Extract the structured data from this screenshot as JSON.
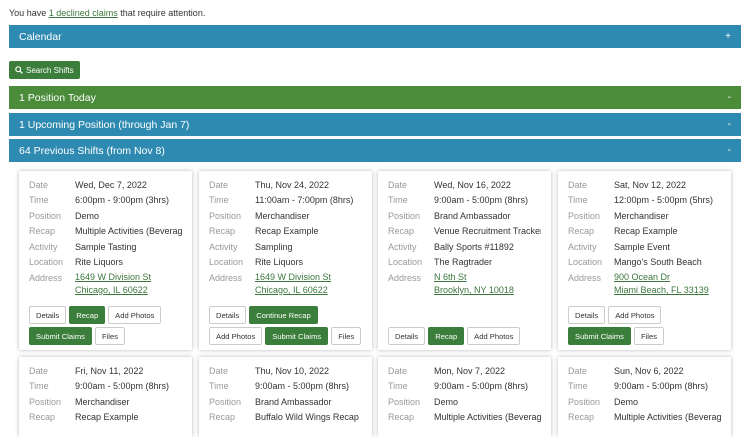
{
  "notice": {
    "prefix": "You have ",
    "link": "1 declined claims",
    "suffix": " that require attention."
  },
  "bars": {
    "calendar": {
      "label": "Calendar",
      "toggle": "+"
    },
    "today": {
      "label": "1 Position Today",
      "toggle": "-"
    },
    "upcoming": {
      "label": "1 Upcoming Position (through Jan 7)",
      "toggle": "-"
    },
    "previous": {
      "label": "64 Previous Shifts (from Nov 8)",
      "toggle": "-"
    }
  },
  "search_label": "Search Shifts",
  "labels": {
    "date": "Date",
    "time": "Time",
    "position": "Position",
    "recap": "Recap",
    "activity": "Activity",
    "location": "Location",
    "address": "Address"
  },
  "cards": [
    {
      "date": "Wed, Dec 7, 2022",
      "time": "6:00pm - 9:00pm (3hrs)",
      "position": "Demo",
      "recap": "Multiple Activities (Beverage)",
      "activity": "Sample Tasting",
      "location": "Rite Liquors",
      "addr1": "1649 W Division St",
      "addr2": "Chicago, IL 60622",
      "buttons": [
        {
          "label": "Details"
        },
        {
          "label": "Recap"
        },
        {
          "label": "Add Photos"
        },
        {
          "label": "Submit Claims"
        },
        {
          "label": "Files"
        }
      ]
    },
    {
      "date": "Thu, Nov 24, 2022",
      "time": "11:00am - 7:00pm (8hrs)",
      "position": "Merchandiser",
      "recap": "Recap Example",
      "activity": "Sampling",
      "location": "Rite Liquors",
      "addr1": "1649 W Division St",
      "addr2": "Chicago, IL 60622",
      "buttons": [
        {
          "label": "Details"
        },
        {
          "label": "Continue Recap"
        },
        {
          "label": "Add Photos"
        },
        {
          "label": "Submit Claims"
        },
        {
          "label": "Files"
        }
      ]
    },
    {
      "date": "Wed, Nov 16, 2022",
      "time": "9:00am - 5:00pm (8hrs)",
      "position": "Brand Ambassador",
      "recap": "Venue Recruitment Tracker",
      "activity": "Bally Sports #11892",
      "location": "The Ragtrader",
      "addr1": "N 6th St",
      "addr2": "Brooklyn, NY 10018",
      "buttons": [
        {
          "label": "Details"
        },
        {
          "label": "Recap"
        },
        {
          "label": "Add Photos"
        }
      ]
    },
    {
      "date": "Sat, Nov 12, 2022",
      "time": "12:00pm - 5:00pm (5hrs)",
      "position": "Merchandiser",
      "recap": "Recap Example",
      "activity": "Sample Event",
      "location": "Mango's South Beach",
      "addr1": "900 Ocean Dr",
      "addr2": "Miami Beach, FL 33139",
      "buttons": [
        {
          "label": "Details"
        },
        {
          "label": "Add Photos"
        },
        {
          "label": "Submit Claims"
        },
        {
          "label": "Files"
        }
      ]
    },
    {
      "date": "Fri, Nov 11, 2022",
      "time": "9:00am - 5:00pm (8hrs)",
      "position": "Merchandiser",
      "recap": "Recap Example"
    },
    {
      "date": "Thu, Nov 10, 2022",
      "time": "9:00am - 5:00pm (8hrs)",
      "position": "Brand Ambassador",
      "recap": "Buffalo Wild Wings Recap"
    },
    {
      "date": "Mon, Nov 7, 2022",
      "time": "9:00am - 5:00pm (8hrs)",
      "position": "Demo",
      "recap": "Multiple Activities (Beverage)"
    },
    {
      "date": "Sun, Nov 6, 2022",
      "time": "9:00am - 5:00pm (8hrs)",
      "position": "Demo",
      "recap": "Multiple Activities (Beverage)"
    }
  ]
}
